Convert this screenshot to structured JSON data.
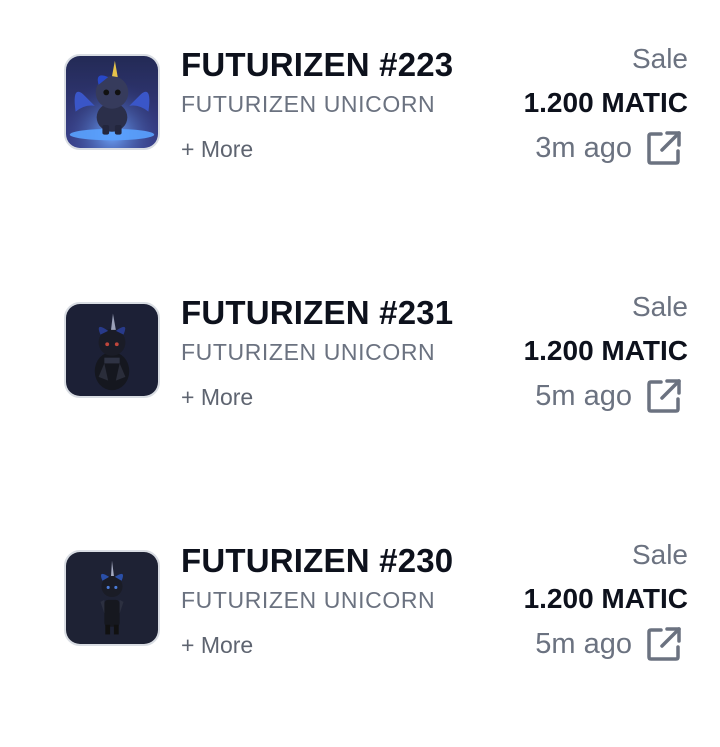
{
  "activities": [
    {
      "nft_name": "FUTURIZEN #223",
      "collection": "FUTURIZEN UNICORN",
      "more_label": "+ More",
      "event": "Sale",
      "price": "1.200 MATIC",
      "time": "3m ago",
      "thumbnail_icon": "blue-winged-unicorn-image",
      "link_icon": "external-link-icon"
    },
    {
      "nft_name": "FUTURIZEN #231",
      "collection": "FUTURIZEN UNICORN",
      "more_label": "+ More",
      "event": "Sale",
      "price": "1.200 MATIC",
      "time": "5m ago",
      "thumbnail_icon": "dark-armored-unicorn-image",
      "link_icon": "external-link-icon"
    },
    {
      "nft_name": "FUTURIZEN #230",
      "collection": "FUTURIZEN UNICORN",
      "more_label": "+ More",
      "event": "Sale",
      "price": "1.200 MATIC",
      "time": "5m ago",
      "thumbnail_icon": "dark-armored-unicorn-image",
      "link_icon": "external-link-icon"
    }
  ],
  "colors": {
    "primary_text": "#0d111c",
    "secondary_text": "#6b7280",
    "thumb_border": "#d9dde3",
    "icon_stroke": "#6b7280"
  }
}
